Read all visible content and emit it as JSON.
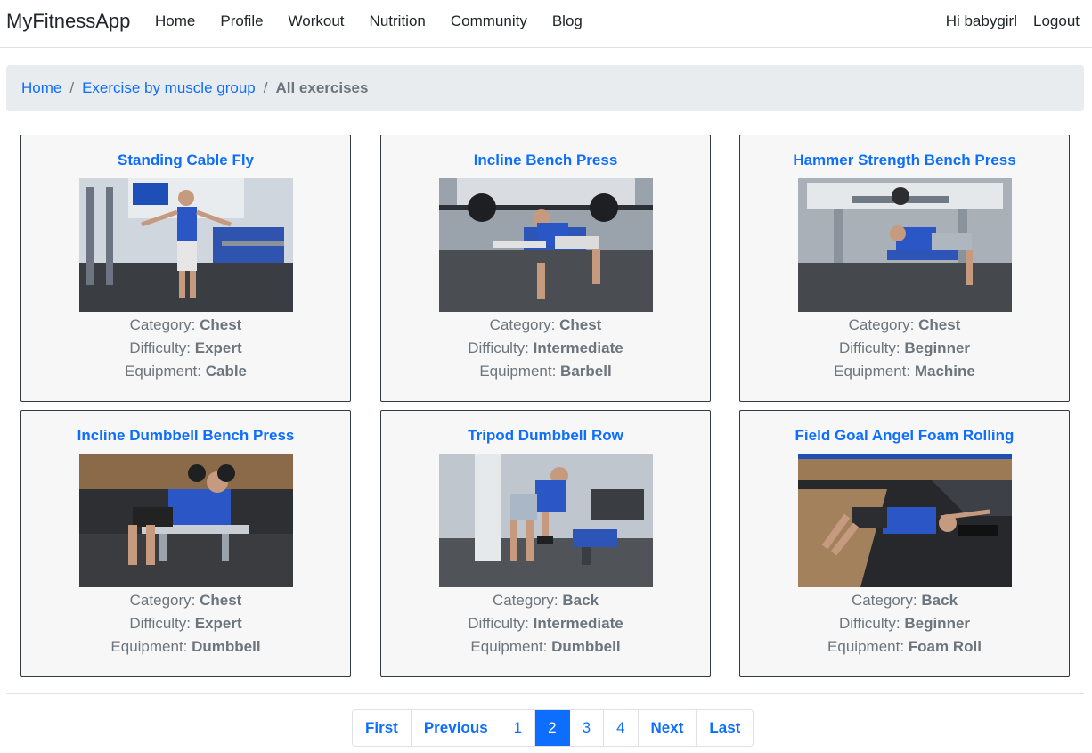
{
  "navbar": {
    "brand": "MyFitnessApp",
    "links": [
      "Home",
      "Profile",
      "Workout",
      "Nutrition",
      "Community",
      "Blog"
    ],
    "greeting": "Hi babygirl",
    "logout": "Logout"
  },
  "breadcrumb": {
    "items": [
      "Home",
      "Exercise by muscle group"
    ],
    "active": "All exercises"
  },
  "labels": {
    "category": "Category:",
    "difficulty": "Difficulty:",
    "equipment": "Equipment:"
  },
  "exercises": [
    {
      "title": "Standing Cable Fly",
      "category": "Chest",
      "difficulty": "Expert",
      "equipment": "Cable"
    },
    {
      "title": "Incline Bench Press",
      "category": "Chest",
      "difficulty": "Intermediate",
      "equipment": "Barbell"
    },
    {
      "title": "Hammer Strength Bench Press",
      "category": "Chest",
      "difficulty": "Beginner",
      "equipment": "Machine"
    },
    {
      "title": "Incline Dumbbell Bench Press",
      "category": "Chest",
      "difficulty": "Expert",
      "equipment": "Dumbbell"
    },
    {
      "title": "Tripod Dumbbell Row",
      "category": "Back",
      "difficulty": "Intermediate",
      "equipment": "Dumbbell"
    },
    {
      "title": "Field Goal Angel Foam Rolling",
      "category": "Back",
      "difficulty": "Beginner",
      "equipment": "Foam Roll"
    }
  ],
  "pagination": {
    "first": "First",
    "previous": "Previous",
    "pages": [
      "1",
      "2",
      "3",
      "4"
    ],
    "current": "2",
    "next": "Next",
    "last": "Last"
  },
  "colors": {
    "link": "#0d6efd",
    "muted": "#6c757d",
    "card_bg": "#f7f7f7",
    "breadcrumb_bg": "#e9ecef"
  }
}
